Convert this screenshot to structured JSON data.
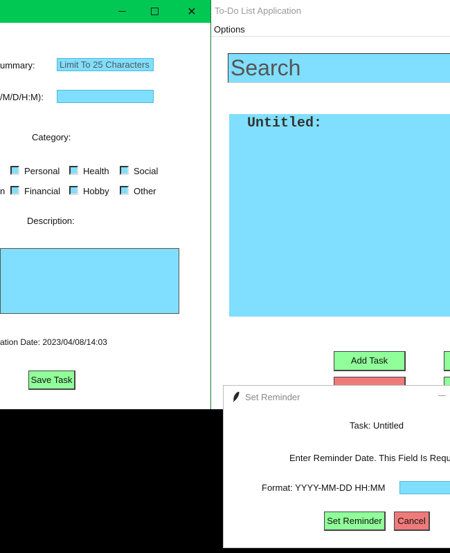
{
  "task_window": {
    "summary_label": "ummary:",
    "summary_placeholder": "Limit To 25 Characters",
    "due_label": "/M/D/H:M):",
    "due_value": "",
    "category_label": "Category:",
    "categories": [
      "Personal",
      "Health",
      "Social",
      "Financial",
      "Hobby",
      "Other"
    ],
    "category_cut_label": "n",
    "description_label": "Description:",
    "creation_date": "ation Date: 2023/04/08/14:03",
    "save_label": "Save Task",
    "controls": {
      "minimize": "—",
      "maximize": "□",
      "close": "✕"
    }
  },
  "main_window": {
    "title": "To-Do List Application",
    "menu": {
      "options": "Options"
    },
    "search_placeholder": "Search",
    "task_title": "Untitled:",
    "add_task_label": "Add Task"
  },
  "reminder_dialog": {
    "title": "Set Reminder",
    "task_line": "Task: Untitled",
    "instruction": "Enter Reminder Date. This Field Is Requir",
    "format_label": "Format: YYYY-MM-DD HH:MM",
    "date_value": "",
    "set_label": "Set Reminder",
    "cancel_label": "Cancel",
    "minimize": "—"
  },
  "colors": {
    "titlebar_green": "#00c853",
    "field_blue": "#80dfff",
    "button_green": "#90ff9a",
    "button_red": "#f07a7a"
  }
}
